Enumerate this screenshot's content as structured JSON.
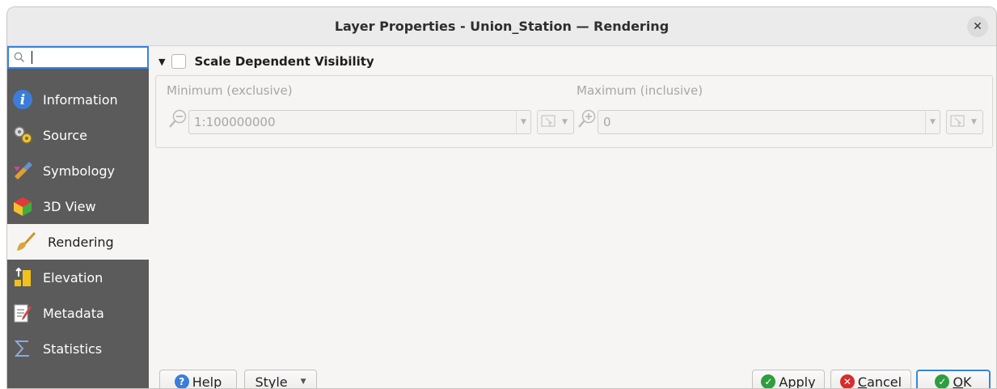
{
  "window": {
    "title": "Layer Properties - Union_Station — Rendering"
  },
  "search": {
    "value": "",
    "placeholder": ""
  },
  "sidebar": {
    "items": [
      {
        "label": "Information",
        "icon": "information-icon"
      },
      {
        "label": "Source",
        "icon": "source-icon"
      },
      {
        "label": "Symbology",
        "icon": "symbology-icon"
      },
      {
        "label": "3D View",
        "icon": "3d-view-icon"
      },
      {
        "label": "Rendering",
        "icon": "rendering-brush-icon",
        "selected": true
      },
      {
        "label": "Elevation",
        "icon": "elevation-icon"
      },
      {
        "label": "Metadata",
        "icon": "metadata-icon"
      },
      {
        "label": "Statistics",
        "icon": "sigma-icon"
      }
    ]
  },
  "scale_visibility": {
    "group_label": "Scale Dependent Visibility",
    "checked": false,
    "min_label": "Minimum (exclusive)",
    "min_value": "1:100000000",
    "max_label": "Maximum (inclusive)",
    "max_value": "0"
  },
  "buttons": {
    "help": "Help",
    "style": "Style",
    "apply": "Apply",
    "cancel_pre": "",
    "cancel_u": "C",
    "cancel_post": "ancel",
    "ok_u": "O",
    "ok_post": "K"
  },
  "colors": {
    "accent": "#3584e4",
    "sidebar_bg": "#5b5b5b",
    "apply_green": "#2e9e3f",
    "cancel_red": "#d92b2b"
  }
}
